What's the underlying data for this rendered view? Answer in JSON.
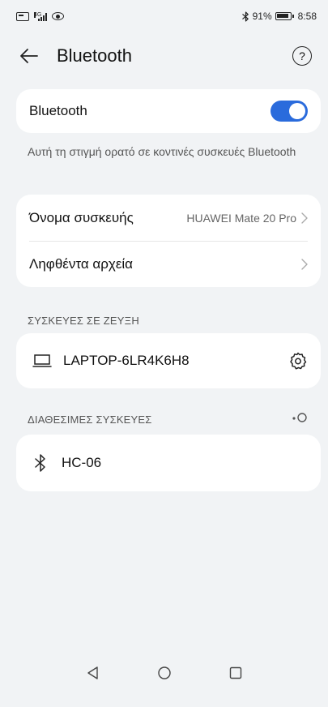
{
  "status_bar": {
    "network_tag": "4G",
    "battery": "91%",
    "time": "8:58"
  },
  "header": {
    "title": "Bluetooth",
    "help_symbol": "?"
  },
  "bluetooth_toggle": {
    "label": "Bluetooth",
    "state": "on"
  },
  "visibility_hint": "Αυτή τη στιγμή ορατό σε κοντινές συσκευές Bluetooth",
  "settings": {
    "device_name_label": "Όνομα συσκευής",
    "device_name_value": "HUAWEI Mate 20 Pro",
    "received_files_label": "Ληφθέντα αρχεία"
  },
  "paired_section": {
    "title": "ΣΥΣΚΕΥΕΣ ΣΕ ΖΕΥΞΗ",
    "devices": [
      {
        "name": "LAPTOP-6LR4K6H8",
        "icon": "laptop-icon"
      }
    ]
  },
  "available_section": {
    "title": "ΔΙΑΘΕΣΙΜΕΣ ΣΥΣΚΕΥΕΣ",
    "devices": [
      {
        "name": "HC-06",
        "icon": "bluetooth-icon"
      }
    ]
  },
  "colors": {
    "accent": "#2a6bdc",
    "background": "#f1f3f5",
    "card": "#ffffff"
  }
}
